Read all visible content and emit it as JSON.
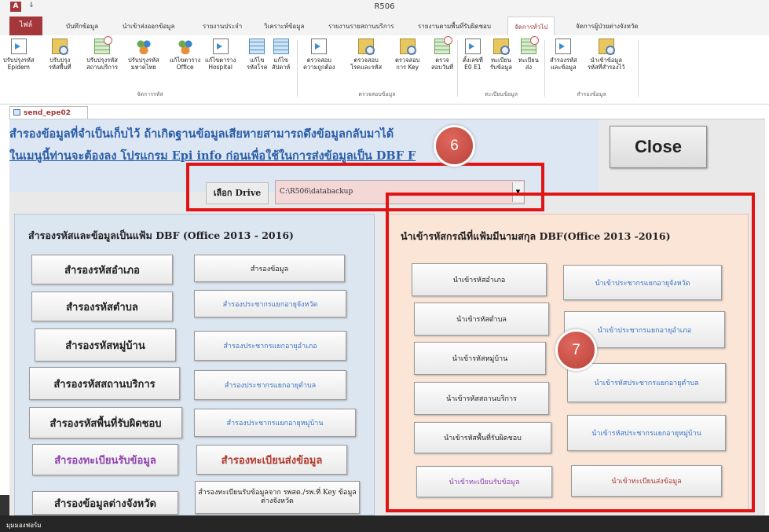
{
  "window": {
    "title": "R506",
    "app_icon": "A",
    "qat": "⇓"
  },
  "tabs": {
    "file": "ไฟล์",
    "items": [
      "บันทึกข้อมูล",
      "นำเข้าส่งออกข้อมูล",
      "รายงานประจำ",
      "วิเคราะห์ข้อมูล",
      "รายงานรายสถานบริการ",
      "รายงานตามพื้นที่รับผิดชอบ",
      "จัดการทั่วไป",
      "จัดการผู้ป่วยต่างจังหวัด"
    ],
    "active": "จัดการทั่วไป"
  },
  "ribbon": {
    "buttons": [
      {
        "l1": "ปรับปรุงรหัส",
        "l2": "Epidem",
        "icon": "doc-arrow-icon"
      },
      {
        "l1": "ปรับปรุง",
        "l2": "รหัสพื้นที่",
        "icon": "magnifier-icon"
      },
      {
        "l1": "ปรับปรุงรหัส",
        "l2": "สถานบริการ",
        "icon": "table-clock-icon"
      },
      {
        "l1": "ปรับปรุงรหัส",
        "l2": "มหาดไทย",
        "icon": "people-icon"
      },
      {
        "l1": "แก้ไขตาราง",
        "l2": "Office",
        "icon": "people-icon"
      },
      {
        "l1": "แก้ไขตาราง",
        "l2": "Hospital",
        "icon": "doc-arrow-icon"
      },
      {
        "l1": "แก้ไข",
        "l2": "รหัสโรค",
        "icon": "table-icon"
      },
      {
        "l1": "แก้ไข",
        "l2": "สัปดาห์",
        "icon": "table-icon"
      },
      {
        "l1": "ตรวจสอบ",
        "l2": "ความถูกต้อง",
        "icon": "doc-arrow-icon"
      },
      {
        "l1": "ตรวจสอบ",
        "l2": "โรคและรหัส",
        "icon": "magnifier-icon"
      },
      {
        "l1": "ตรวจสอบ",
        "l2": "การ Key",
        "icon": "magnifier-icon"
      },
      {
        "l1": "ตรวจ",
        "l2": "สอบวันที่",
        "icon": "table-clock-icon"
      },
      {
        "l1": "ตั้งเลขที่",
        "l2": "E0 E1",
        "icon": "doc-arrow-icon"
      },
      {
        "l1": "ทะเบียน",
        "l2": "รับข้อมูล",
        "icon": "magnifier-icon"
      },
      {
        "l1": "ทะเบียน",
        "l2": "ส่ง",
        "icon": "table-clock-icon"
      },
      {
        "l1": "สำรองรหัส",
        "l2": "และข้อมูล",
        "icon": "doc-arrow-icon"
      },
      {
        "l1": "นำเข้าข้อมูล",
        "l2": "รหัสที่สำรองไว้",
        "icon": "magnifier-icon"
      }
    ],
    "groups": [
      "จัดการรหัส",
      "ตรวจสอบข้อมูล",
      "ทะเบียนข้อมูล",
      "สำรองข้อมูล"
    ]
  },
  "form_tab": "send_epe02",
  "header": {
    "line1": "สำรองข้อมูลที่จำเป็นเก็บไว้ ถ้าเกิดฐานข้อมูลเสียหายสามารถดึงข้อมูลกลับมาได้",
    "line2": "ในเมนูนี้ท่านจะต้องลง โปรแกรม Epi info ก่อนเพื่อใช้ในการส่งข้อมูลเป็น DBF F"
  },
  "close_label": "Close",
  "drive": {
    "label": "เลือก Drive",
    "value": "C:\\R506\\databackup"
  },
  "left_panel": {
    "title": "สำรองรหัสและข้อมูลเป็นแฟ้ม DBF (Office 2013 - 2016)",
    "col1": [
      "สำรองรหัสอำเภอ",
      "สำรองรหัสตำบล",
      "สำรองรหัสหมู่บ้าน",
      "สำรองรหัสสถานบริการ",
      "สำรองรหัสพื้นที่รับผิดชอบ",
      "สำรองทะเบียนรับข้อมูล",
      "สำรองข้อมูลต่างจังหวัด"
    ],
    "col2": [
      "สำรองข้อมูล",
      "สำรองประชากรแยกอายุจังหวัด",
      "สำรองประชากรแยกอายุอำเภอ",
      "สำรองประชากรแยกอายุตำบล",
      "สำรองประชากรแยกอายุหมู่บ้าน",
      "สำรองทะเบียนส่งข้อมูล",
      "สำรองทะเบียนรับข้อมูลจาก รพสต./รพ.ที่ Key ข้อมูลต่างจังหวัด"
    ]
  },
  "right_panel": {
    "title": "นำเข้ารหัสกรณีที่แฟ้มมีนามสกุล DBF(Office 2013 -2016)",
    "col1": [
      "นำเข้ารหัสอำเภอ",
      "นำเข้ารหัสตำบล",
      "นำเข้ารหัสหมู่บ้าน",
      "นำเข้ารหัสสถานบริการ",
      "นำเข้ารหัสพื้นที่รับผิดชอบ",
      "นำเข้าทะเบียนรับข้อมูล"
    ],
    "col2": [
      "นำเข้าประชากรแยกอายุจังหวัด",
      "นำเข้าประชากรแยกอายุอำเภอ",
      "นำเข้ารหัสประชากรแยกอายุตำบล",
      "นำเข้ารหัสประชากรแยกอายุหมู่บ้าน",
      "นำเข้าทะเบียนส่งข้อมูล"
    ]
  },
  "callouts": [
    "6",
    "7"
  ],
  "status": "มุมมองฟอร์ม",
  "colors": {
    "accent": "#a4373a",
    "header_text": "#2b5da8",
    "highlight_red": "#e01414"
  }
}
